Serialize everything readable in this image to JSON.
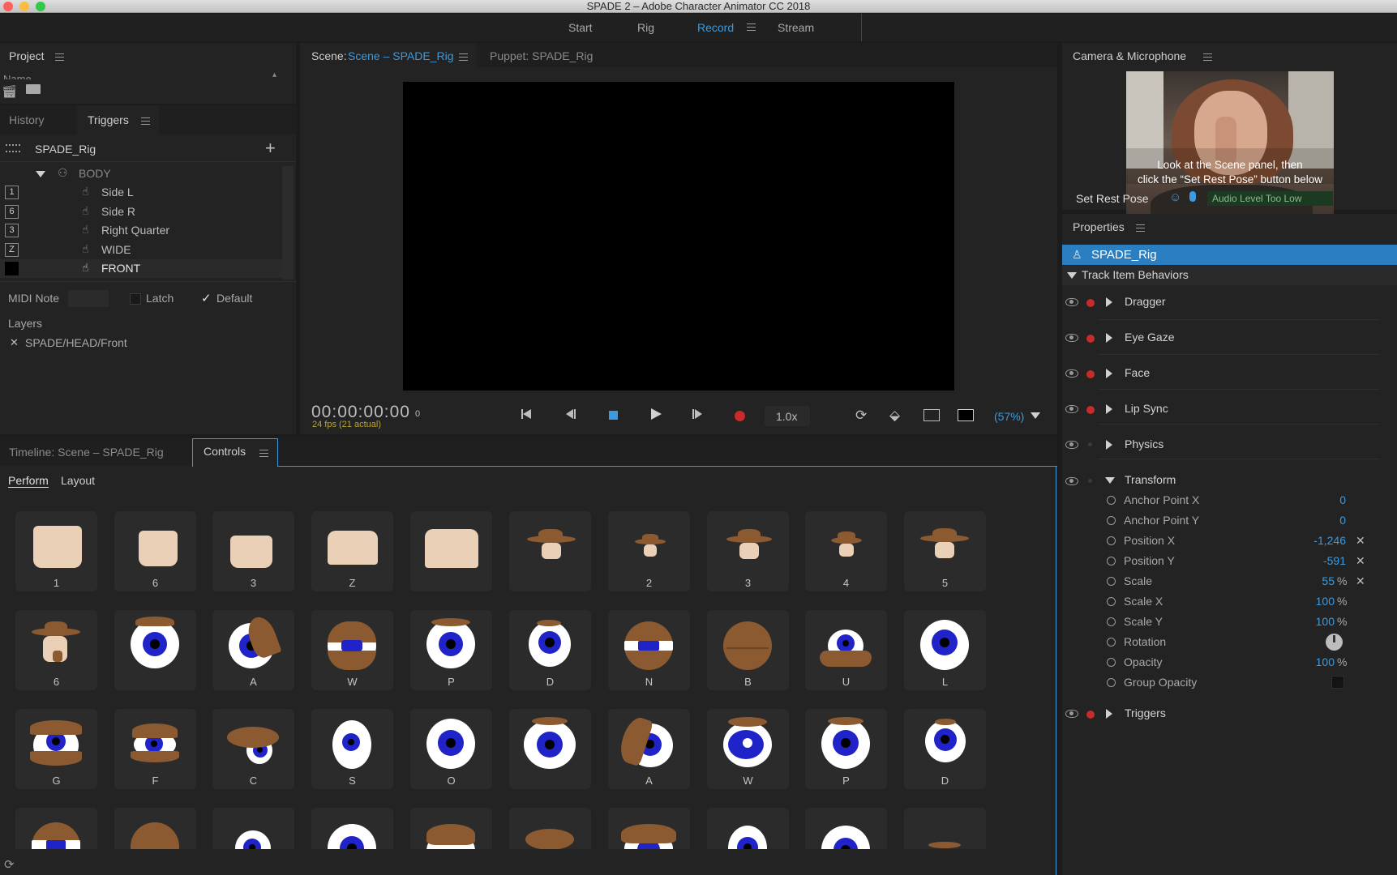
{
  "app": {
    "title": "SPADE 2 – Adobe Character Animator CC 2018"
  },
  "workspace_tabs": [
    {
      "label": "Start",
      "active": false
    },
    {
      "label": "Rig",
      "active": false
    },
    {
      "label": "Record",
      "active": true
    },
    {
      "label": "Stream",
      "active": false
    }
  ],
  "project": {
    "title": "Project",
    "name_header": "Name"
  },
  "triggers_panel": {
    "tabs": [
      {
        "label": "History"
      },
      {
        "label": "Triggers"
      }
    ],
    "puppet": "SPADE_Rig",
    "group": "BODY",
    "items": [
      {
        "key": "1",
        "label": "Side L"
      },
      {
        "key": "6",
        "label": "Side R"
      },
      {
        "key": "3",
        "label": "Right Quarter"
      },
      {
        "key": "Z",
        "label": "WIDE"
      },
      {
        "key": "",
        "label": "FRONT"
      }
    ],
    "midi_label": "MIDI Note",
    "latch_label": "Latch",
    "default_label": "Default",
    "layers_label": "Layers",
    "layer_path": "SPADE/HEAD/Front"
  },
  "scene": {
    "scene_prefix": "Scene:",
    "scene_name": "Scene – SPADE_Rig",
    "puppet_tab": "Puppet: SPADE_Rig",
    "timecode": "00:00:00:00",
    "frame": "0",
    "fps": "24 fps (21 actual)",
    "speed": "1.0x",
    "zoom": "(57%)"
  },
  "bottom_tabs": [
    {
      "label": "Timeline: Scene – SPADE_Rig"
    },
    {
      "label": "Controls"
    }
  ],
  "controls": {
    "subtabs": [
      {
        "label": "Perform"
      },
      {
        "label": "Layout"
      }
    ],
    "row1": [
      "1",
      "6",
      "3",
      "Z",
      "",
      "",
      "2",
      "3",
      "4",
      "5"
    ],
    "row2": [
      "6",
      "",
      "A",
      "W",
      "P",
      "D",
      "N",
      "B",
      "U",
      "L"
    ],
    "row3": [
      "G",
      "F",
      "C",
      "S",
      "O",
      "",
      "A",
      "W",
      "P",
      "D"
    ]
  },
  "camera": {
    "title": "Camera & Microphone",
    "instruction_line1": "Look at the Scene panel, then",
    "instruction_line2": "click the “Set Rest Pose” button below",
    "set_rest_pose": "Set Rest Pose",
    "audio_status": "Audio Level Too Low"
  },
  "properties": {
    "title": "Properties",
    "puppet": "SPADE_Rig",
    "section": "Track Item Behaviors",
    "behaviors": [
      {
        "name": "Dragger",
        "armed": true
      },
      {
        "name": "Eye Gaze",
        "armed": true
      },
      {
        "name": "Face",
        "armed": true
      },
      {
        "name": "Lip Sync",
        "armed": true
      },
      {
        "name": "Physics",
        "armed": false
      }
    ],
    "transform": {
      "name": "Transform",
      "params": [
        {
          "label": "Anchor Point X",
          "value": "0",
          "unit": ""
        },
        {
          "label": "Anchor Point Y",
          "value": "0",
          "unit": ""
        },
        {
          "label": "Position X",
          "value": "-1,246",
          "unit": ""
        },
        {
          "label": "Position Y",
          "value": "-591",
          "unit": ""
        },
        {
          "label": "Scale",
          "value": "55",
          "unit": "%"
        },
        {
          "label": "Scale X",
          "value": "100",
          "unit": "%"
        },
        {
          "label": "Scale Y",
          "value": "100",
          "unit": "%"
        },
        {
          "label": "Rotation",
          "value": "",
          "unit": ""
        },
        {
          "label": "Opacity",
          "value": "100",
          "unit": "%"
        },
        {
          "label": "Group Opacity",
          "value": "",
          "unit": ""
        }
      ]
    },
    "triggers": "Triggers"
  },
  "colors": {
    "accent": "#3a9be0",
    "record": "#c92a2a",
    "selected_row": "#2b7ec0",
    "skin": "#ead0b6",
    "lid": "#8c5a30",
    "iris": "#1f23c8"
  }
}
